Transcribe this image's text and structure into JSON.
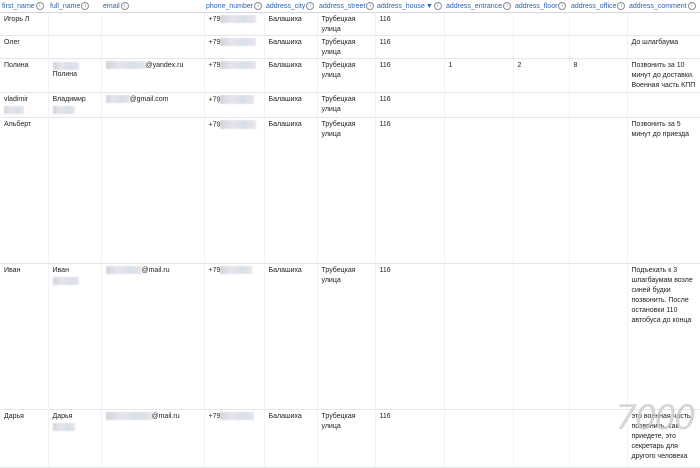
{
  "columns": [
    {
      "key": "first_name",
      "label": "first_name"
    },
    {
      "key": "full_name",
      "label": "full_name"
    },
    {
      "key": "email",
      "label": "email"
    },
    {
      "key": "phone_number",
      "label": "phone_number"
    },
    {
      "key": "address_city",
      "label": "address_city"
    },
    {
      "key": "address_street",
      "label": "address_street"
    },
    {
      "key": "address_house",
      "label": "address_house"
    },
    {
      "key": "address_entrance",
      "label": "address_entrance"
    },
    {
      "key": "address_floor",
      "label": "address_floor"
    },
    {
      "key": "address_office",
      "label": "address_office"
    },
    {
      "key": "address_comment",
      "label": "address_comment"
    }
  ],
  "sort_indicator": "▼",
  "hint_glyph": "⊜",
  "rows": [
    {
      "first_name": "Игорь Л",
      "full_name": "",
      "email": "",
      "phone_number": "+79",
      "address_city": "Балашиха",
      "address_street": "Трубецкая улица",
      "address_house": "116",
      "address_entrance": "",
      "address_floor": "",
      "address_office": "",
      "address_comment": ""
    },
    {
      "first_name": "Олег",
      "full_name": "",
      "email": "",
      "phone_number": "+79",
      "address_city": "Балашиха",
      "address_street": "Трубецкая улица",
      "address_house": "116",
      "address_entrance": "",
      "address_floor": "",
      "address_office": "",
      "address_comment": "До шлагбаума"
    },
    {
      "first_name": "Полина",
      "full_name": "Полина",
      "email": "@yandex.ru",
      "phone_number": "+79",
      "address_city": "Балашиха",
      "address_street": "Трубецкая улица",
      "address_house": "116",
      "address_entrance": "1",
      "address_floor": "2",
      "address_office": "8",
      "address_comment": "Позвонить за 10 минут до доставки. Военная часть КПП"
    },
    {
      "first_name": "vladimir",
      "full_name": "Владимир",
      "email": "@gmail.com",
      "phone_number": "+79",
      "address_city": "Балашиха",
      "address_street": "Трубецкая улица",
      "address_house": "116",
      "address_entrance": "",
      "address_floor": "",
      "address_office": "",
      "address_comment": ""
    },
    {
      "first_name": "Альберт",
      "full_name": "",
      "email": "",
      "phone_number": "+79",
      "address_city": "Балашиха",
      "address_street": "Трубецкая улица",
      "address_house": "116",
      "address_entrance": "",
      "address_floor": "",
      "address_office": "",
      "address_comment": "Позвонить за 5 минут до приезда"
    },
    {
      "first_name": "Иван",
      "full_name": "Иван",
      "email": "@mail.ru",
      "phone_number": "+79",
      "address_city": "Балашиха",
      "address_street": "Трубецкая улица",
      "address_house": "116",
      "address_entrance": "",
      "address_floor": "",
      "address_office": "",
      "address_comment": "Подъехать к 3 шлагбаумам возле синей будки позвонить. После остановки 110 автобуса до конца"
    },
    {
      "first_name": "Дарья",
      "full_name": "Дарья",
      "email": "@mail.ru",
      "phone_number": "+79",
      "address_city": "Балашиха",
      "address_street": "Трубецкая улица",
      "address_house": "116",
      "address_entrance": "",
      "address_floor": "",
      "address_office": "",
      "address_comment": "это военная часть, позвонить, как приедете, это секретарь для другого человека"
    }
  ],
  "watermark": "7000"
}
